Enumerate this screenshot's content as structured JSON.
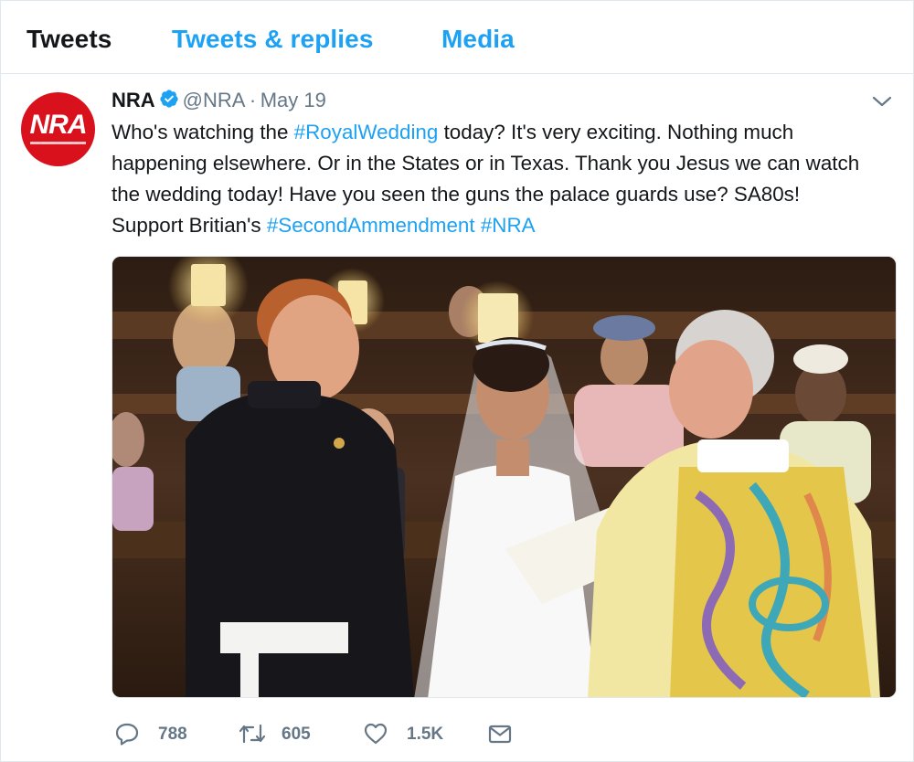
{
  "tabs": [
    {
      "label": "Tweets",
      "active": true
    },
    {
      "label": "Tweets & replies",
      "active": false
    },
    {
      "label": "Media",
      "active": false
    }
  ],
  "tweet": {
    "avatar": {
      "text": "NRA",
      "icon": "nra-logo-avatar"
    },
    "author_name": "NRA",
    "verified_icon": "verified-badge-icon",
    "handle": "@NRA",
    "separator": "·",
    "date": "May 19",
    "menu_icon": "chevron-down-icon",
    "text": {
      "p1": "Who's watching the ",
      "tag1": "#RoyalWedding",
      "p2": " today? It's very exciting. Nothing much happening elsewhere. Or in the States or in Texas. Thank you Jesus we can watch the wedding today! Have you seen the guns the palace guards use? SA80s! Support Britian's ",
      "tag2": "#SecondAmmendment",
      "p3": " ",
      "tag3": "#NRA"
    },
    "actions": {
      "reply": {
        "icon": "reply-icon",
        "count": "788"
      },
      "retweet": {
        "icon": "retweet-icon",
        "count": "605"
      },
      "like": {
        "icon": "heart-icon",
        "count": "1.5K"
      },
      "dm": {
        "icon": "envelope-icon"
      }
    }
  },
  "colors": {
    "accent": "#1da1f2",
    "text": "#14171a",
    "secondary": "#657786",
    "border": "#e1e8ed",
    "nra_red": "#d8111c"
  }
}
